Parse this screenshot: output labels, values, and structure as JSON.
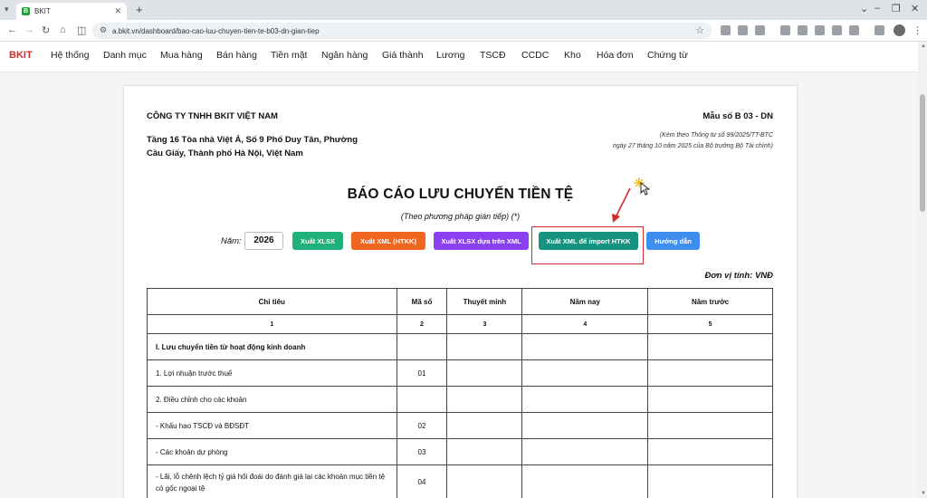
{
  "browser": {
    "tab_title": "BKIT",
    "favicon_letter": "B",
    "new_tab": "+",
    "url": "a.bkit.vn/dashboard/bao-cao-luu-chuyen-tien-te-b03-dn-gian-tiep",
    "window_controls": [
      "⌄",
      "–",
      "❐",
      "✕"
    ]
  },
  "app": {
    "brand": "BKIT",
    "nav": [
      "Hệ thống",
      "Danh mục",
      "Mua hàng",
      "Bán hàng",
      "Tiền mặt",
      "Ngân hàng",
      "Giá thành",
      "Lương",
      "TSCĐ",
      "CCDC",
      "Kho",
      "Hóa đơn",
      "Chứng từ"
    ]
  },
  "report": {
    "company": "CÔNG TY TNHH BKIT VIỆT NAM",
    "address": "Tầng 16 Tòa nhà Việt Á, Số 9 Phố Duy Tân, Phường Cầu Giấy, Thành phố Hà Nội, Việt Nam",
    "form_no": "Mẫu số B 03 - DN",
    "note_line1": "(Kèm theo Thông tư số 99/2025/TT-BTC",
    "note_line2": "ngày 27 tháng 10 năm 2025 của Bộ trưởng Bộ Tài chính)",
    "title": "BÁO CÁO LƯU CHUYỂN TIỀN TỆ",
    "subtitle": "(Theo phương pháp gián tiếp) (*)",
    "year_label": "Năm:",
    "year_value": "2026",
    "buttons": {
      "xlsx": "Xuất XLSX",
      "xml_htkk": "Xuất XML (HTKK)",
      "xlsx_xml": "Xuất XLSX dựa trên XML",
      "xml_import": "Xuất XML để import HTKK",
      "guide": "Hướng dẫn"
    },
    "button_colors": {
      "xlsx": "#1fb17b",
      "xml_htkk": "#f1661f",
      "xlsx_xml": "#8a3ff0",
      "xml_import": "#16937e",
      "guide": "#3e8ef0"
    },
    "unit": "Đơn vị tính: VNĐ",
    "columns": [
      "Chỉ tiêu",
      "Mã số",
      "Thuyết minh",
      "Năm nay",
      "Năm trước"
    ],
    "column_index": [
      "1",
      "2",
      "3",
      "4",
      "5"
    ],
    "rows": [
      {
        "label": "I. Lưu chuyển tiền từ hoạt động kinh doanh",
        "code": "",
        "bold": true
      },
      {
        "label": "1. Lợi nhuận trước thuế",
        "code": "01"
      },
      {
        "label": "2. Điều chỉnh cho các khoản",
        "code": ""
      },
      {
        "label": "- Khấu hao TSCĐ và BĐSĐT",
        "code": "02"
      },
      {
        "label": "- Các khoản dự phòng",
        "code": "03"
      },
      {
        "label": "- Lãi, lỗ chênh lệch tỷ giá hối đoái do đánh giá lại các khoản mục tiền tệ có gốc ngoại tệ",
        "code": "04"
      }
    ]
  }
}
